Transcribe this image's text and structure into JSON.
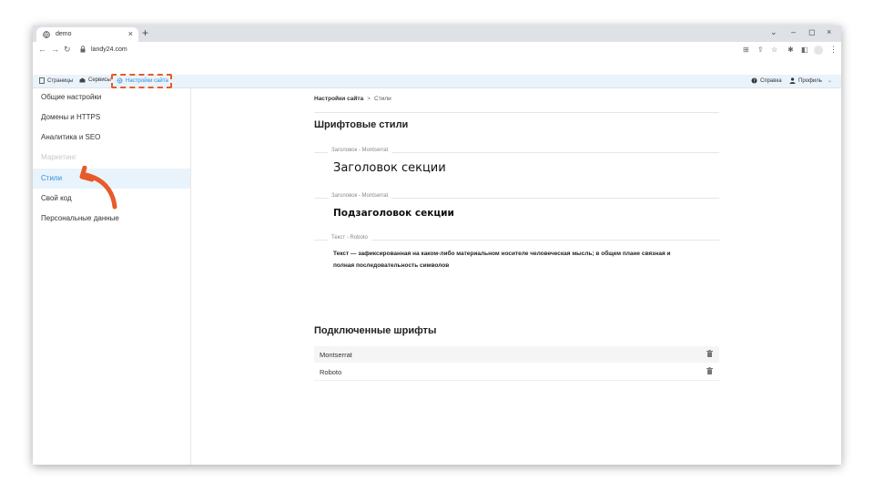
{
  "browser": {
    "tab_title": "demo",
    "tab_close": "×",
    "new_tab": "+",
    "url": "landy24.com",
    "window_controls": [
      "⌄",
      "–",
      "◻",
      "×"
    ]
  },
  "appbar": {
    "pages": "Страницы",
    "services": "Сервисы",
    "site_settings": "Настройки сайта",
    "help": "Справка",
    "profile": "Профиль"
  },
  "sidebar": {
    "items": [
      {
        "label": "Общие настройки"
      },
      {
        "label": "Домены и HTTPS"
      },
      {
        "label": "Аналитика и SEO"
      },
      {
        "label": "Маркетинг"
      },
      {
        "label": "Стили"
      },
      {
        "label": "Свой код"
      },
      {
        "label": "Персональные данные"
      }
    ]
  },
  "breadcrumb": {
    "parent": "Настройки сайта",
    "separator": ">",
    "current": "Стили"
  },
  "font_styles": {
    "title": "Шрифтовые стили",
    "heading_label": "Заголовок - Montserrat",
    "heading_sample": "Заголовок секции",
    "subheading_label": "Заголовок - Montserrat",
    "subheading_sample": "Подзаголовок секции",
    "text_label": "Текст - Roboto",
    "text_sample_line1": "Текст — зафиксированная на каком-либо материальном носителе человеческая мысль; в общем плане связная и",
    "text_sample_line2": "полная последовательность символов"
  },
  "connected_fonts": {
    "title": "Подключенные шрифты",
    "fonts": [
      "Montserrat",
      "Roboto"
    ]
  },
  "colors": {
    "accent": "#2f8ed8",
    "annotation": "#e85a2a",
    "sidebar_active_bg": "#e9f3fb"
  }
}
